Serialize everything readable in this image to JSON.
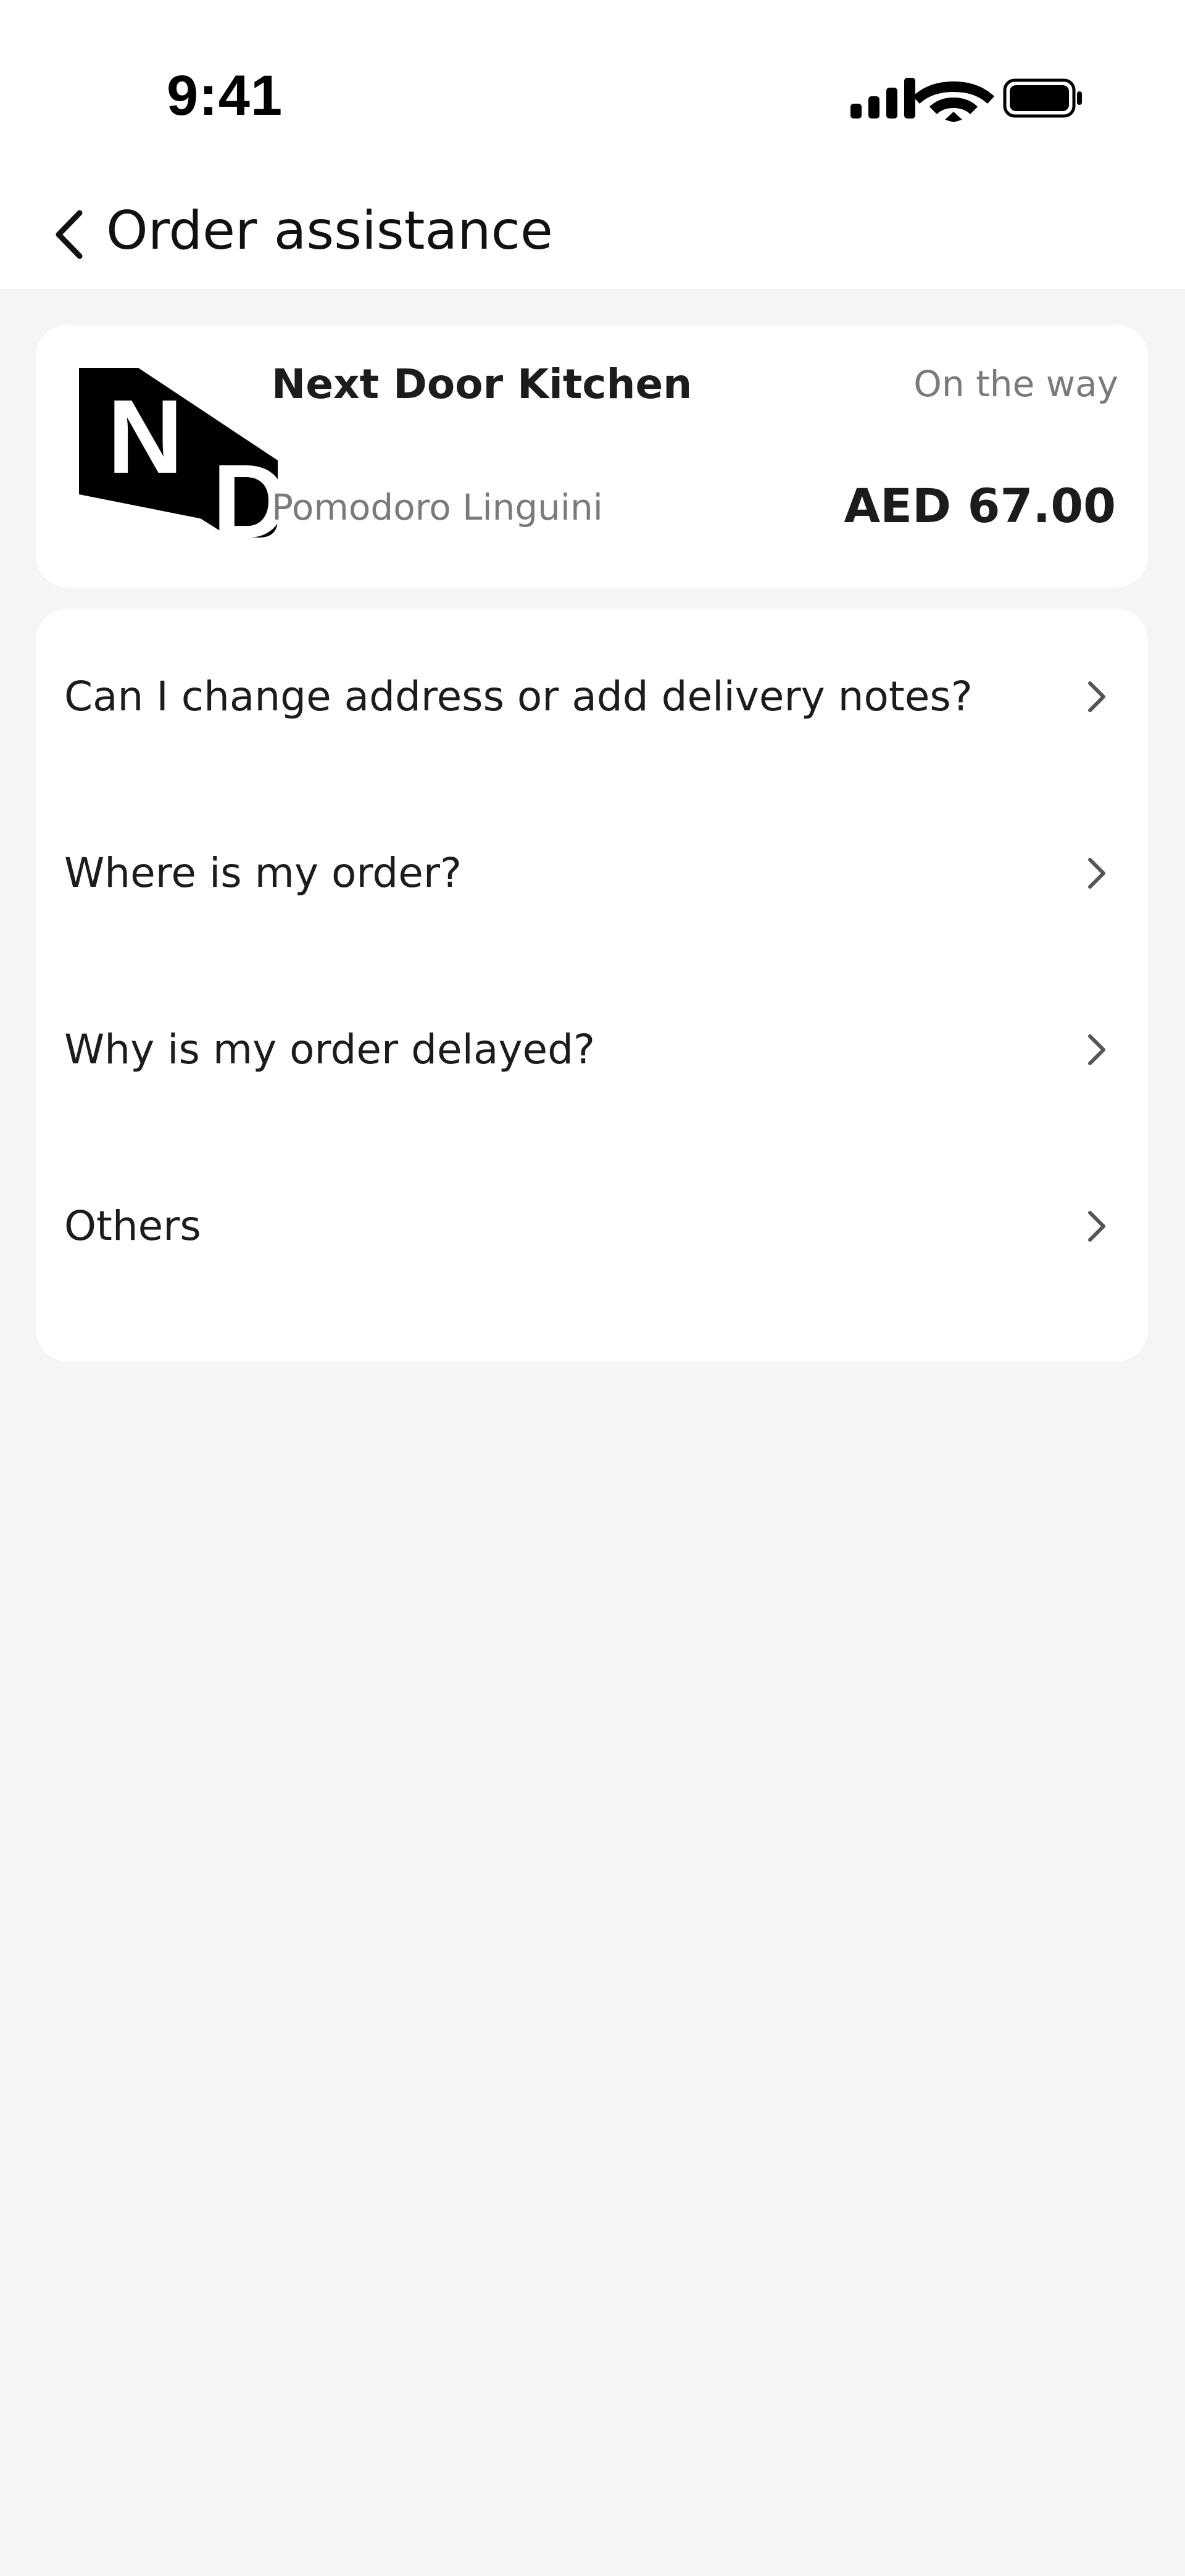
{
  "status_bar": {
    "time": "9:41",
    "icons": [
      "cellular-signal-icon",
      "wifi-icon",
      "battery-icon"
    ]
  },
  "header": {
    "back_icon": "chevron-left-icon",
    "title": "Order assistance"
  },
  "order": {
    "logo_letters": [
      "N",
      "D"
    ],
    "restaurant": "Next Door Kitchen",
    "status": "On the way",
    "item": "Pomodoro Linguini",
    "price": "AED 67.00"
  },
  "questions": [
    {
      "label": "Can I change address or add delivery notes?"
    },
    {
      "label": "Where is my order?"
    },
    {
      "label": "Why is my order delayed?"
    },
    {
      "label": "Others"
    }
  ],
  "colors": {
    "background": "#f5f5f5",
    "card": "#ffffff",
    "muted_text": "#7a7a7a",
    "primary_text": "#1c1c1c"
  }
}
